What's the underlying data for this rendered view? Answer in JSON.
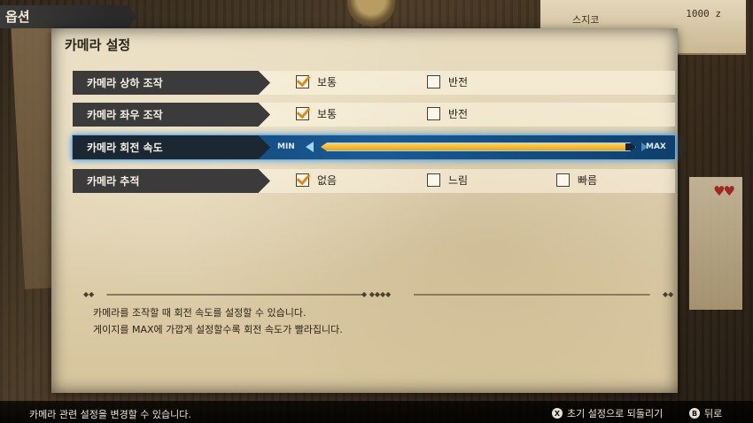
{
  "header": {
    "title": "옵션"
  },
  "background": {
    "note_label": "스지코",
    "money": "1000 z"
  },
  "panel": {
    "title": "카메라 설정",
    "rows": [
      {
        "label": "카메라 상하 조작",
        "options": [
          {
            "label": "보통",
            "checked": true
          },
          {
            "label": "반전",
            "checked": false
          }
        ]
      },
      {
        "label": "카메라 좌우 조작",
        "options": [
          {
            "label": "보통",
            "checked": true
          },
          {
            "label": "반전",
            "checked": false
          }
        ]
      },
      {
        "label": "카메라 회전 속도",
        "slider": {
          "min_label": "MIN",
          "max_label": "MAX",
          "value_fraction": 0.97
        }
      },
      {
        "label": "카메라 추적",
        "options": [
          {
            "label": "없음",
            "checked": true
          },
          {
            "label": "느림",
            "checked": false
          },
          {
            "label": "빠름",
            "checked": false
          }
        ]
      }
    ],
    "description": [
      "카메라를 조작할 때 회전 속도를 설정할 수 있습니다.",
      "게이지를 MAX에 가깝게 설정할수록 회전 속도가 빨라집니다."
    ]
  },
  "footer": {
    "hint": "카메라 관련 설정을 변경할 수 있습니다.",
    "reset": {
      "key": "X",
      "label": "초기 설정으로 되돌리기"
    },
    "back": {
      "key": "B",
      "label": "뒤로"
    }
  },
  "colors": {
    "check": "#e08a14",
    "selected_row": "#1a5a93",
    "slider_fill": "#e7a514"
  }
}
